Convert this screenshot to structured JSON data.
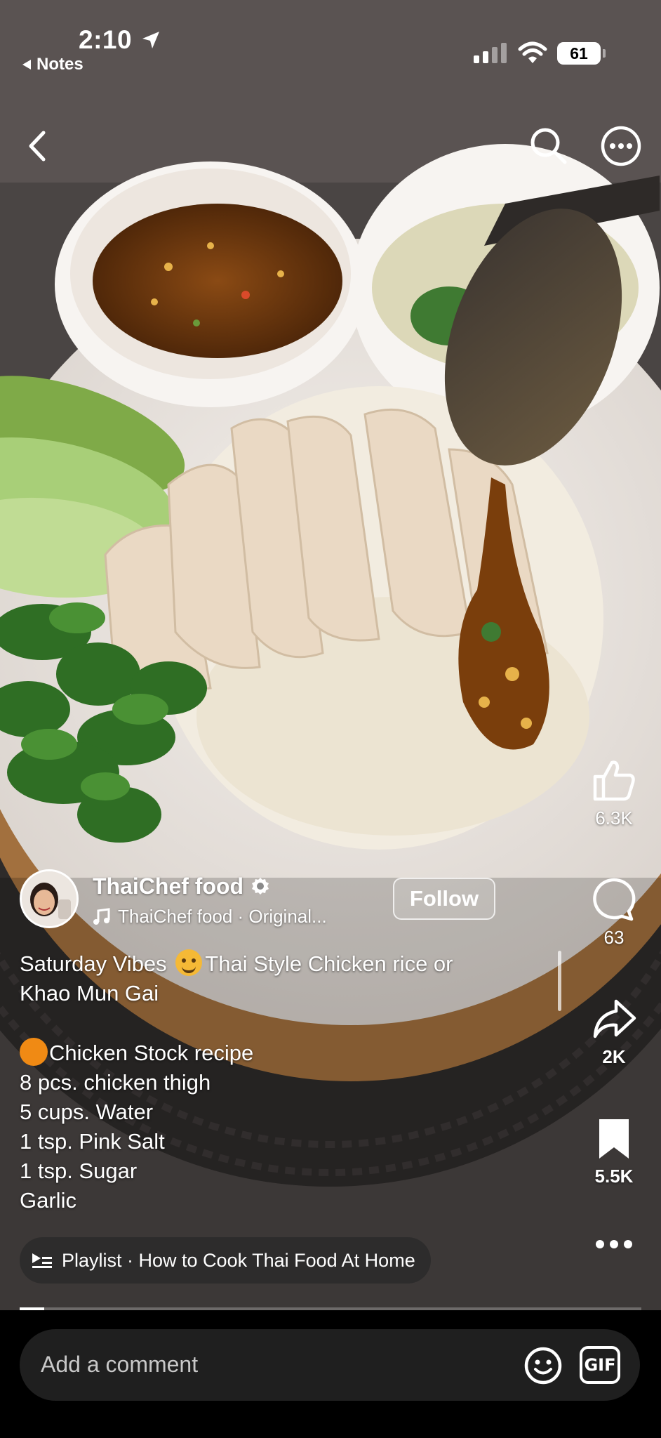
{
  "status_bar": {
    "time": "2:10",
    "back_app": "Notes",
    "battery": "61"
  },
  "author": {
    "name": "ThaiChef food",
    "audio": "ThaiChef food · Original...",
    "follow_label": "Follow"
  },
  "rail": {
    "likes": "6.3K",
    "comments": "63",
    "shares": "2K",
    "saves": "5.5K"
  },
  "caption": {
    "line1a": "Saturday Vibes ",
    "line1b": "Thai Style Chicken rice or",
    "line2": "Khao Mun Gai",
    "line3": "Chicken Stock recipe",
    "line4": "8 pcs. chicken thigh",
    "line5": "5 cups. Water",
    "line6": "1 tsp. Pink Salt",
    "line7": "1 tsp. Sugar",
    "line8": "Garlic"
  },
  "playlist": {
    "label": "Playlist · How to Cook Thai Food At Home"
  },
  "video": {
    "progress": 0.04
  },
  "comment": {
    "placeholder": "Add a comment",
    "gif_label": "GIF"
  },
  "icons": {
    "back": "chevron-left-icon",
    "search": "search-icon",
    "more": "more-horizontal-icon",
    "like": "thumbs-up-icon",
    "comment": "comment-bubble-icon",
    "share": "share-arrow-icon",
    "save": "bookmark-icon",
    "emoji": "smiley-icon"
  }
}
